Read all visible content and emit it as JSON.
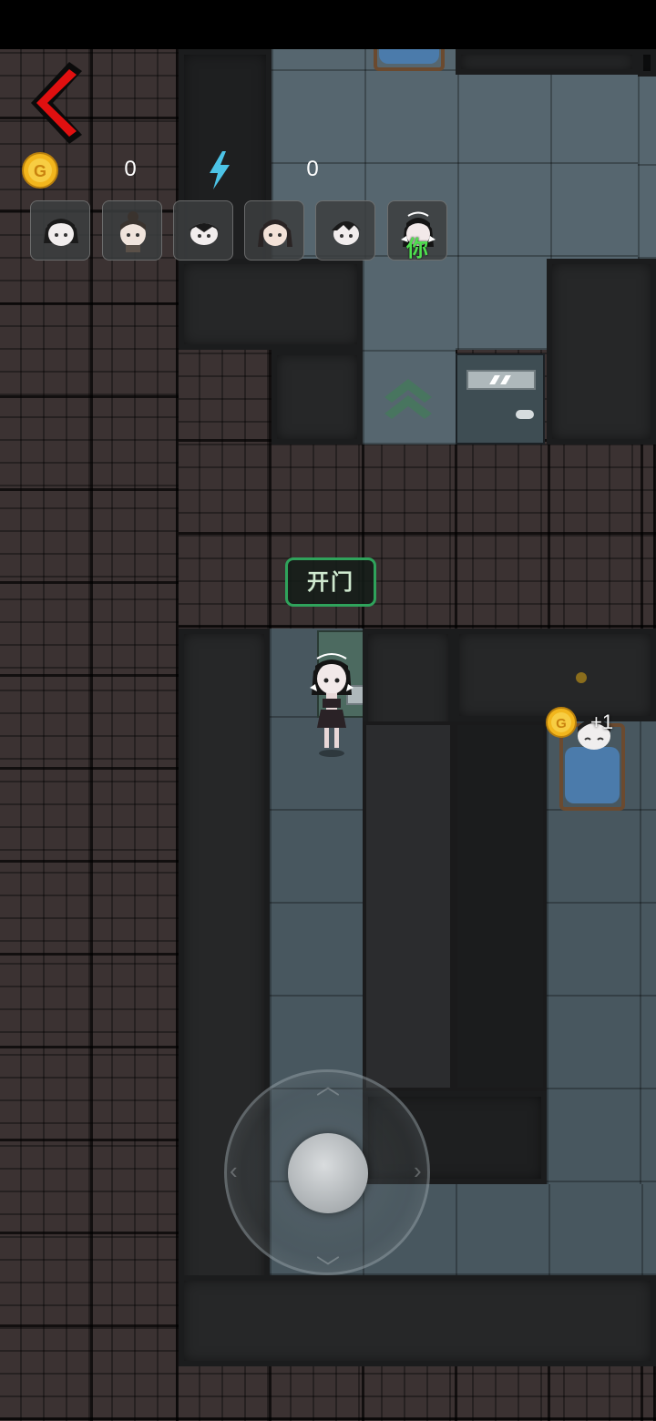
{
  "hud": {
    "coin_count": "0",
    "energy_count": "0",
    "coin_letter": "G",
    "players": [
      {
        "name": "player-1",
        "is_you": false
      },
      {
        "name": "player-2",
        "is_you": false
      },
      {
        "name": "player-3",
        "is_you": false
      },
      {
        "name": "player-4",
        "is_you": false
      },
      {
        "name": "player-5",
        "is_you": false
      },
      {
        "name": "player-6",
        "is_you": true,
        "tag": "你"
      }
    ]
  },
  "actions": {
    "open_door_label": "开门"
  },
  "floating": {
    "coin_reward_label": "+1",
    "coin_letter": "G"
  },
  "colors": {
    "back_arrow": "#e01010",
    "coin": "#f2b61d",
    "energy": "#4cc3e6",
    "open_door_border": "#2fa35b",
    "you_tag": "#4fe04f"
  }
}
